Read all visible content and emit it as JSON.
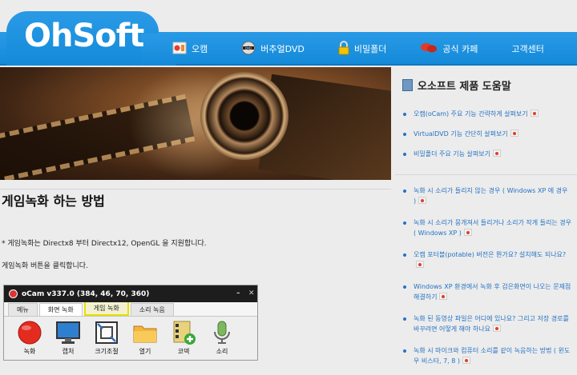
{
  "header": {
    "logo": "OhSoft",
    "nav": [
      {
        "label": "오캠",
        "icon": "ocam-icon"
      },
      {
        "label": "버추얼DVD",
        "icon": "dvd-icon"
      },
      {
        "label": "비밀폴더",
        "icon": "lock-icon"
      },
      {
        "label": "공식 카페",
        "icon": "chat-bubbles-icon"
      },
      {
        "label": "고객센터",
        "icon": ""
      }
    ]
  },
  "main": {
    "title": "게임녹화 하는 방법",
    "para1": "* 게임녹화는 Directx8 부터 Directx12, OpenGL 을 지원합니다.",
    "para2": "게임녹화 버튼을 클릭합니다.",
    "ocam": {
      "window_title": "oCam v337.0 (384, 46, 70, 360)",
      "tabs": [
        "메뉴",
        "화면 녹화",
        "게임 녹화",
        "소리 녹음"
      ],
      "tools": [
        "녹화",
        "캡처",
        "크기조절",
        "열기",
        "코덱",
        "소리"
      ]
    }
  },
  "sidebar": {
    "heading": "오소프트 제품 도움말",
    "group1": [
      "오캠(oCam) 주요 기능 간략하게 살펴보기",
      "VirtualDVD 기능 간단히 살펴보기",
      "비밀폴더 주요 기능 살펴보기"
    ],
    "group2": [
      "녹화 시 소리가 들리지 않는 경우 ( Windows XP 에 경우 )",
      "녹화 시 소리가 뭉개져서 들리거나 소리가 작게 들리는 경우 ( Windows XP )",
      "오캠 포터블(potable) 버전은 뭔가요? 설치해도 되나요?",
      "Windows XP 환경에서 녹화 후 검은화면이 나오는 문제점 해결하기",
      "녹화 된 동영상 파일은 어디에 있나요? 그리고 저장 경로를 바꾸려면 어떻게 해야 하나요",
      "녹화 시 마이크와 컴퓨터 소리를 같이 녹음하는 방법 ( 윈도우 비스타, 7, 8 )"
    ]
  },
  "colors": {
    "header_blue": "#1a93e0",
    "link_blue": "#2573c4",
    "tab_highlight": "#e6e000"
  }
}
